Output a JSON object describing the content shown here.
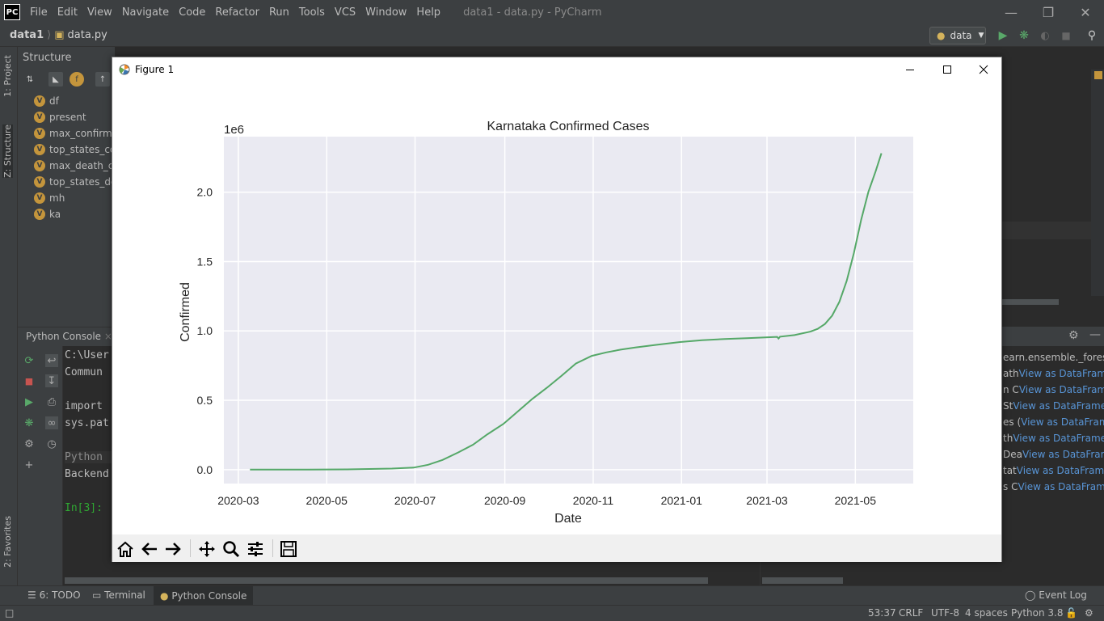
{
  "app": {
    "logo_text": "PC",
    "menu": [
      "File",
      "Edit",
      "View",
      "Navigate",
      "Code",
      "Refactor",
      "Run",
      "Tools",
      "VCS",
      "Window",
      "Help"
    ],
    "window_title": "data1 - data.py - PyCharm"
  },
  "navbar": {
    "project": "data1",
    "file": "data.py",
    "run_config": "data"
  },
  "left_stripe": {
    "project_tab": "1: Project",
    "structure_tab": "Z: Structure",
    "favorites_tab": "2: Favorites"
  },
  "structure": {
    "title": "Structure",
    "items": [
      "df",
      "present",
      "max_confirme",
      "top_states_con",
      "max_death_ca",
      "top_states_dea",
      "mh",
      "ka"
    ]
  },
  "console": {
    "tab_label": "Python Console",
    "lines": [
      "C:\\User",
      " Commun",
      "",
      "import ",
      "sys.pat",
      "",
      "Python ",
      "Backend",
      "",
      "In[3]:"
    ]
  },
  "variables": [
    {
      "name": "earn.ensemble._forest.R",
      "link": ""
    },
    {
      "name": "ath",
      "link": "View as DataFrame"
    },
    {
      "name": "n C",
      "link": "View as DataFrame"
    },
    {
      "name": " St",
      "link": "View as DataFrame"
    },
    {
      "name": "es (",
      "link": "View as DataFrame"
    },
    {
      "name": "th ",
      "link": "View as DataFrame"
    },
    {
      "name": "Dea",
      "link": "View as DataFrame"
    },
    {
      "name": "tat",
      "link": "View as DataFrame"
    },
    {
      "name": "s C",
      "link": "View as DataFrame"
    }
  ],
  "bottom_tabs": {
    "todo": "6: TODO",
    "terminal": "Terminal",
    "python_console": "Python Console",
    "event_log": "Event Log"
  },
  "status": {
    "position": "53:37",
    "line_sep": "CRLF",
    "encoding": "UTF-8",
    "indent": "4 spaces",
    "interpreter": "Python 3.8"
  },
  "figure": {
    "window_title": "Figure 1"
  },
  "colors": {
    "line": "#55a868",
    "axes_bg": "#eaeaf2",
    "link": "#5894d5"
  },
  "chart_data": {
    "type": "line",
    "title": "Karnataka Confirmed Cases",
    "xlabel": "Date",
    "ylabel": "Confirmed",
    "offset_label": "1e6",
    "y_scale_multiplier": 1000000,
    "xlim": [
      "2020-02-20",
      "2021-06-10"
    ],
    "ylim": [
      -0.1,
      2.4
    ],
    "x_ticks": [
      "2020-03",
      "2020-05",
      "2020-07",
      "2020-09",
      "2020-11",
      "2021-01",
      "2021-03",
      "2021-05"
    ],
    "y_ticks": [
      0.0,
      0.5,
      1.0,
      1.5,
      2.0
    ],
    "y_tick_labels": [
      "0.0",
      "0.5",
      "1.0",
      "1.5",
      "2.0"
    ],
    "grid": true,
    "series": [
      {
        "x": [
          "2020-03-09",
          "2020-04-15",
          "2020-05-15",
          "2020-06-15",
          "2020-06-30",
          "2020-07-10",
          "2020-07-20",
          "2020-07-31",
          "2020-08-10",
          "2020-08-20",
          "2020-08-31",
          "2020-09-10",
          "2020-09-20",
          "2020-09-30",
          "2020-10-10",
          "2020-10-20",
          "2020-10-31",
          "2020-11-10",
          "2020-11-20",
          "2020-11-30",
          "2020-12-15",
          "2020-12-31",
          "2021-01-15",
          "2021-01-31",
          "2021-02-15",
          "2021-02-28",
          "2021-03-08",
          "2021-03-09",
          "2021-03-10",
          "2021-03-20",
          "2021-03-31",
          "2021-04-05",
          "2021-04-10",
          "2021-04-15",
          "2021-04-20",
          "2021-04-25",
          "2021-04-30",
          "2021-05-05",
          "2021-05-10",
          "2021-05-15",
          "2021-05-19"
        ],
        "y": [
          0.0,
          0.0,
          0.002,
          0.008,
          0.015,
          0.035,
          0.07,
          0.125,
          0.18,
          0.255,
          0.33,
          0.42,
          0.51,
          0.59,
          0.675,
          0.765,
          0.82,
          0.845,
          0.865,
          0.88,
          0.9,
          0.92,
          0.933,
          0.942,
          0.948,
          0.953,
          0.957,
          0.945,
          0.958,
          0.97,
          0.995,
          1.015,
          1.05,
          1.11,
          1.21,
          1.36,
          1.56,
          1.8,
          2.0,
          2.15,
          2.28
        ]
      }
    ]
  }
}
